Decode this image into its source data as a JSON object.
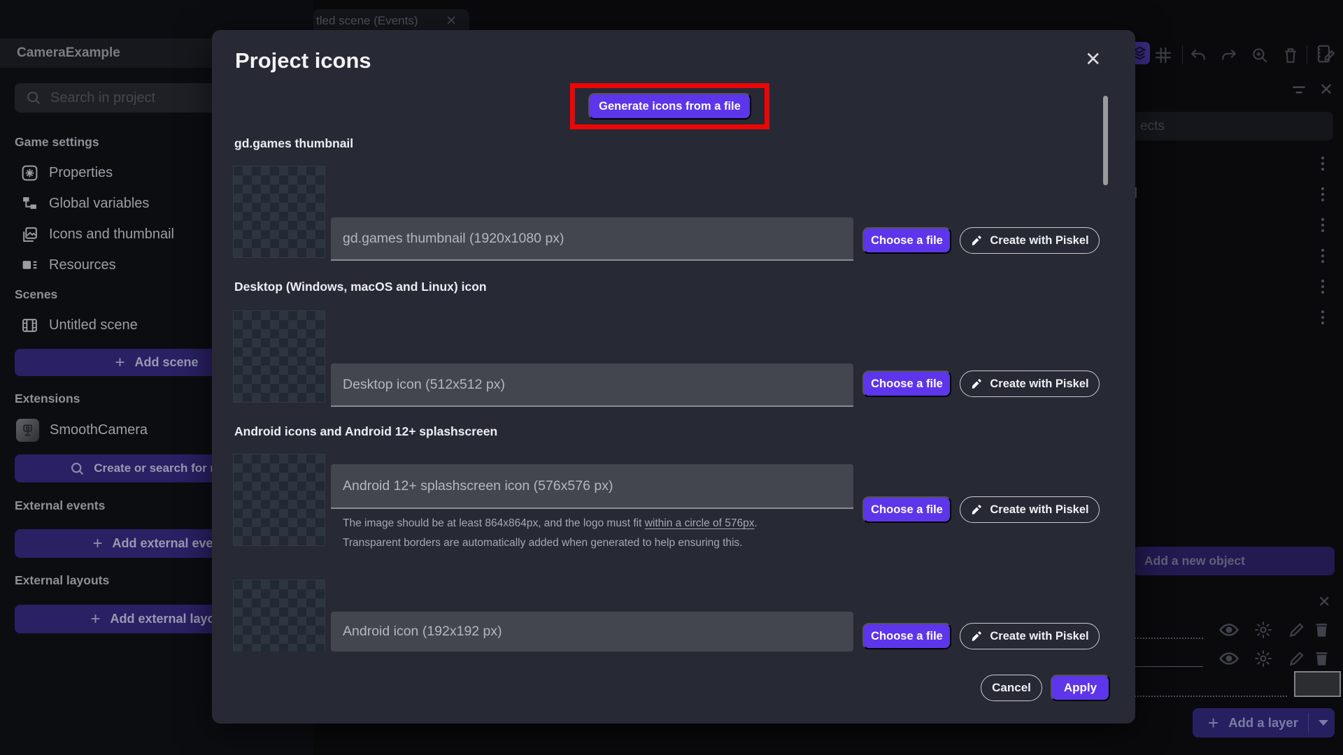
{
  "tab": {
    "label": "tled scene (Events)"
  },
  "sidebar": {
    "title": "CameraExample",
    "search_placeholder": "Search in project",
    "sections": {
      "game_settings": "Game settings",
      "scenes": "Scenes",
      "extensions": "Extensions",
      "external_events": "External events",
      "external_layouts": "External layouts"
    },
    "items": {
      "properties": "Properties",
      "global_variables": "Global variables",
      "icons_and_thumbnail": "Icons and thumbnail",
      "resources": "Resources",
      "untitled_scene": "Untitled scene",
      "smooth_camera": "SmoothCamera"
    },
    "buttons": {
      "add_scene": "Add scene",
      "search_extensions": "Create or search for new e",
      "add_external_event": "Add external even",
      "add_external_layout": "Add external layou"
    }
  },
  "dialog": {
    "title": "Project icons",
    "generate_button": "Generate icons from a file",
    "choose_file": "Choose a file",
    "create_with_piskel": "Create with Piskel",
    "cancel": "Cancel",
    "apply": "Apply",
    "accent_color": "#5d35ea",
    "annotation_color": "#ee0505",
    "sections": {
      "gdgames": {
        "label": "gd.games thumbnail",
        "field": "gd.games thumbnail (1920x1080 px)"
      },
      "desktop": {
        "label": "Desktop (Windows, macOS and Linux) icon",
        "field": "Desktop icon (512x512 px)"
      },
      "android": {
        "label": "Android icons and Android 12+ splashscreen",
        "field_splash": "Android 12+ splashscreen icon (576x576 px)",
        "helper_prefix": "The image should be at least 864x864px, and the logo must fit ",
        "helper_link": "within a circle of 576px",
        "helper_suffix": ".",
        "helper_line2": "Transparent borders are automatically added when generated to help ensuring this.",
        "field_icon": "Android icon (192x192 px)"
      }
    }
  },
  "right_panel": {
    "objects_search_fragment": "ects",
    "row_fragment_1": "l",
    "row_fragment_2": "d",
    "add_new_object": "Add a new object",
    "add_a_layer": "Add a layer"
  }
}
